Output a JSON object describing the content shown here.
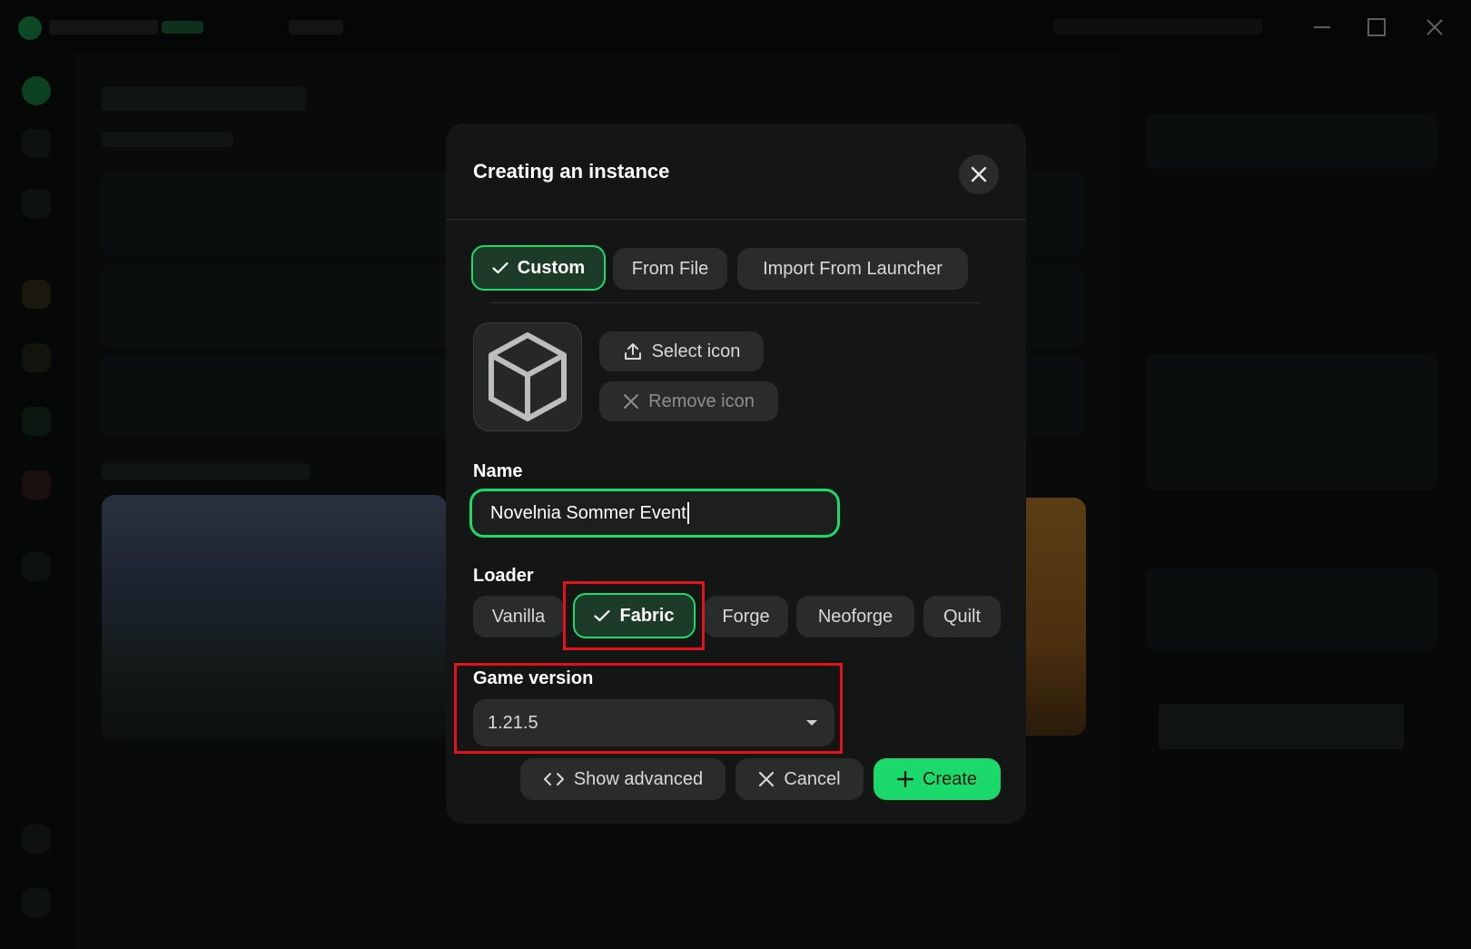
{
  "modal": {
    "title": "Creating an instance",
    "tabs": [
      {
        "label": "Custom",
        "active": true
      },
      {
        "label": "From File",
        "active": false
      },
      {
        "label": "Import From Launcher",
        "active": false
      }
    ],
    "icon": {
      "select_label": "Select icon",
      "remove_label": "Remove icon"
    },
    "name": {
      "label": "Name",
      "value": "Novelnia Sommer Event"
    },
    "loader": {
      "label": "Loader",
      "options": [
        {
          "label": "Vanilla",
          "active": false
        },
        {
          "label": "Fabric",
          "active": true
        },
        {
          "label": "Forge",
          "active": false
        },
        {
          "label": "Neoforge",
          "active": false
        },
        {
          "label": "Quilt",
          "active": false
        }
      ]
    },
    "game_version": {
      "label": "Game version",
      "value": "1.21.5"
    },
    "actions": {
      "advanced_label": "Show advanced",
      "cancel_label": "Cancel",
      "create_label": "Create"
    }
  },
  "colors": {
    "accent": "#1bd96a",
    "annotation": "#e3121b",
    "modal_bg": "#141615"
  }
}
